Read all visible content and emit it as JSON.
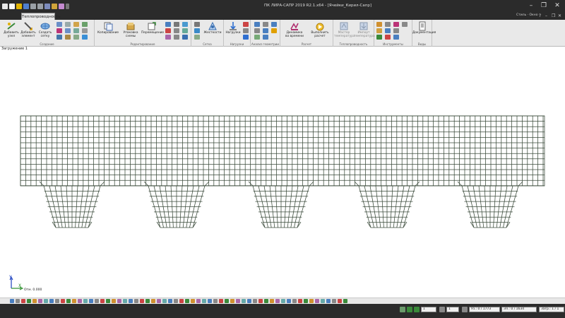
{
  "window": {
    "title": "ПК ЛИРА-САПР 2019 R2.1.x64 - [Ячейки_Кирил-Сапр]",
    "controls": [
      "–",
      "❐",
      "✕"
    ]
  },
  "ribbon": {
    "active_tab": "Теплопроводность",
    "style_combo": "Стиль · Окно ·",
    "row_controls": [
      "?",
      "–",
      "❐",
      "✕"
    ],
    "groups": [
      {
        "label": "Создание",
        "buttons": [
          "Добавить\nузел",
          "Добавить\nэлемент",
          "Создать\nсетку"
        ]
      },
      {
        "label": "Редактирование",
        "buttons": [
          "Копирование",
          "Упаковка\nсхемы",
          "Перемещение"
        ]
      },
      {
        "label": "Сетка",
        "buttons": [
          "Жесткости"
        ]
      },
      {
        "label": "Нагрузки",
        "buttons": [
          "Нагрузки"
        ]
      },
      {
        "label": "Анализ геометрии",
        "buttons": []
      },
      {
        "label": "Расчет",
        "buttons": [
          "Динамика\nво времени",
          "Выполнить\nрасчет"
        ]
      },
      {
        "label": "Теплопроводность",
        "buttons": [
          "Мастер\nтемпература",
          "Импорт\nтемпература"
        ]
      },
      {
        "label": "Инструменты",
        "buttons": []
      },
      {
        "label": "Виды",
        "buttons": [
          "Документация"
        ]
      }
    ],
    "colors": {
      "dark": "#2b2b2b",
      "panel": "#e9e9e9",
      "accent": "#2f7fd8"
    }
  },
  "workspace": {
    "load_case": "Загружение 1",
    "axis_labels": [
      "Y",
      "X"
    ],
    "scale_note": "Отм. 0.000",
    "mesh_color": "#3a4a3a"
  },
  "status": {
    "selected_value": "1",
    "page": "1",
    "nodes": "Уз.: 0 / 1773",
    "elements": "Эл.: 0 / 1634",
    "loads": "Загр.: 1 / 1"
  }
}
